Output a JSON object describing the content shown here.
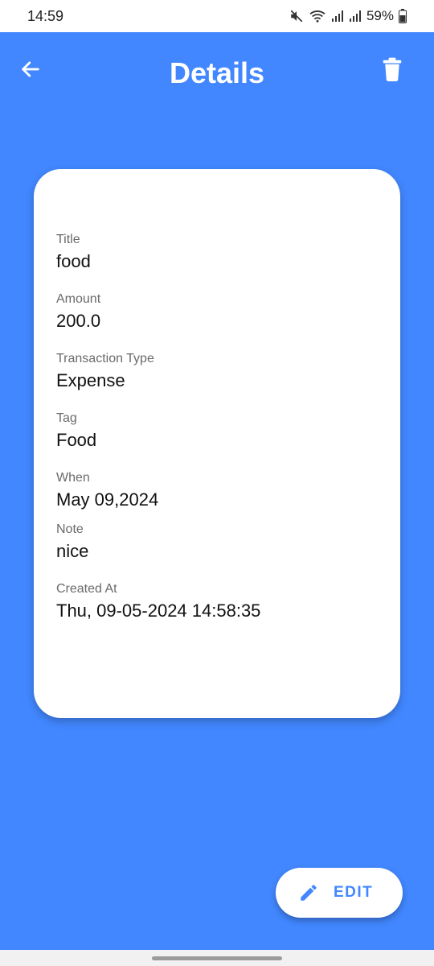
{
  "status_bar": {
    "time": "14:59",
    "battery": "59%"
  },
  "header": {
    "title": "Details",
    "back_icon": "arrow-left-icon",
    "delete_icon": "trash-icon"
  },
  "details": {
    "fields": [
      {
        "label": "Title",
        "value": "food"
      },
      {
        "label": "Amount",
        "value": "200.0"
      },
      {
        "label": "Transaction Type",
        "value": "Expense"
      },
      {
        "label": "Tag",
        "value": "Food"
      },
      {
        "label": "When",
        "value": "May 09,2024"
      },
      {
        "label": "Note",
        "value": "nice"
      },
      {
        "label": "Created At",
        "value": "Thu, 09-05-2024 14:58:35"
      }
    ]
  },
  "fab": {
    "label": "EDIT",
    "icon": "pencil-icon"
  },
  "colors": {
    "primary": "#4287ff",
    "card": "#ffffff"
  }
}
